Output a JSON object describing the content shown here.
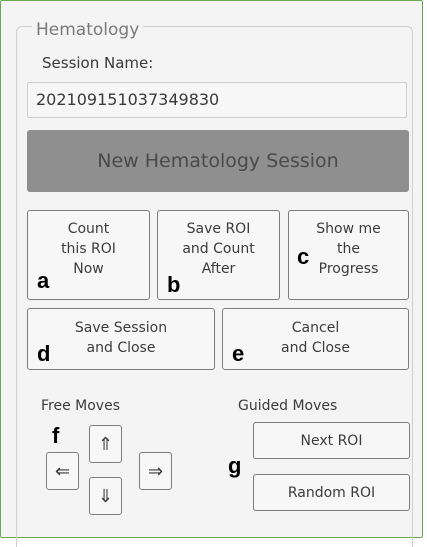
{
  "panel": {
    "legend": "Hematology",
    "session_name_label": "Session Name:",
    "session_name_value": "202109151037349830",
    "new_session_label": "New Hematology Session"
  },
  "actions": {
    "count_now_label": "Count\nthis ROI\nNow",
    "save_roi_label": "Save ROI\nand Count\nAfter",
    "show_progress_label": "Show me\nthe\nProgress",
    "save_session_label": "Save Session\nand Close",
    "cancel_label": "Cancel\nand Close"
  },
  "markers": {
    "a": "a",
    "b": "b",
    "c": "c",
    "d": "d",
    "e": "e",
    "f": "f",
    "g": "g"
  },
  "free_moves": {
    "label": "Free Moves",
    "up_icon": "⇑",
    "down_icon": "⇓",
    "left_icon": "⇐",
    "right_icon": "⇒"
  },
  "guided_moves": {
    "label": "Guided Moves",
    "next_label": "Next ROI",
    "random_label": "Random ROI"
  },
  "colors": {
    "outer_border": "#6aa84f",
    "disabled_button": "#8f8f8f"
  }
}
